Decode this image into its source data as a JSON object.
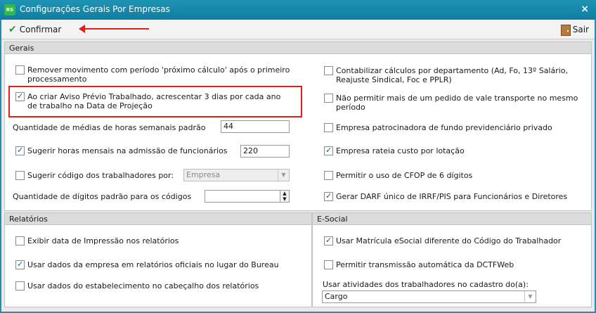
{
  "window": {
    "title": "Configurações Gerais Por Empresas",
    "close_label": "×",
    "icon_text": "RS"
  },
  "toolbar": {
    "confirm_label": "Confirmar",
    "exit_label": "Sair"
  },
  "sections": {
    "gerais": "Gerais",
    "relatorios": "Relatórios",
    "esocial": "E-Social"
  },
  "gerais_left": [
    {
      "label": "Remover movimento com período 'próximo cálculo' após o primeiro",
      "label2": "processamento",
      "checked": false
    },
    {
      "label": "Ao criar Aviso Prévio Trabalhado, acrescentar 3 dias por cada ano",
      "label2": "de trabalho na Data de Projeção",
      "checked": true
    }
  ],
  "qtd_medias": {
    "label": "Quantidade de médias de horas semanais padrão",
    "value": "44"
  },
  "sugerir_horas": {
    "label": "Sugerir horas mensais na admissão de funcionários",
    "value": "220",
    "checked": true
  },
  "sugerir_codigo": {
    "label": "Sugerir código dos trabalhadores por:",
    "value": "Empresa",
    "checked": false
  },
  "qtd_digitos": {
    "label": "Quantidade de dígitos padrão para os códigos",
    "value": ""
  },
  "gerais_right": [
    {
      "label": "Contabilizar cálculos por departamento (Ad, Fo, 13º Salário,",
      "label2": "Reajuste Sindical, Foc e PPLR)",
      "checked": false
    },
    {
      "label": "Não permitir mais de um pedido de vale transporte no mesmo",
      "label2": "período",
      "checked": false
    },
    {
      "label": "Empresa patrocinadora de fundo previdenciário privado",
      "label2": "",
      "checked": false
    },
    {
      "label": "Empresa rateia custo por lotação",
      "label2": "",
      "checked": true
    },
    {
      "label": "Permitir o uso de CFOP de 6 dígitos",
      "label2": "",
      "checked": false
    },
    {
      "label": "Gerar DARF único de IRRF/PIS para Funcionários e Diretores",
      "label2": "",
      "checked": true
    }
  ],
  "relatorios": [
    {
      "label": "Exibir data de Impressão nos relatórios",
      "checked": false
    },
    {
      "label": "Usar dados da empresa em relatórios oficiais no lugar do Bureau",
      "checked": true
    },
    {
      "label": "Usar dados do estabelecimento no cabeçalho dos relatórios",
      "checked": false
    }
  ],
  "esocial": [
    {
      "label": "Usar Matrícula eSocial diferente do Código do Trabalhador",
      "checked": true
    },
    {
      "label": "Permitir transmissão automática da DCTFWeb",
      "checked": false
    }
  ],
  "esocial_atividades": {
    "label": "Usar atividades dos trabalhadores no cadastro do(a):",
    "value": "Cargo"
  }
}
